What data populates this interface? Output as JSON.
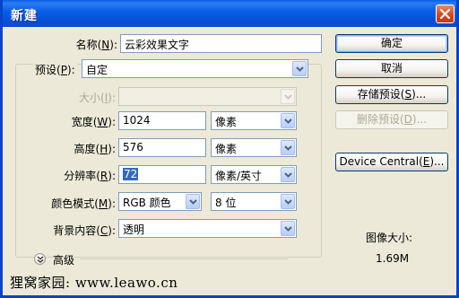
{
  "window": {
    "title": "新建",
    "close_icon": "close-icon"
  },
  "form": {
    "name": {
      "label": "名称(",
      "mnemonic": "N",
      "label_end": "):",
      "value": "云彩效果文字"
    },
    "preset": {
      "label": "预设(",
      "mnemonic": "P",
      "label_end": "):",
      "value": "自定"
    },
    "size": {
      "label": "大小(",
      "mnemonic": "I",
      "label_end": "):",
      "value": ""
    },
    "width": {
      "label": "宽度(",
      "mnemonic": "W",
      "label_end": "):",
      "value": "1024",
      "unit": "像素"
    },
    "height": {
      "label": "高度(",
      "mnemonic": "H",
      "label_end": "):",
      "value": "576",
      "unit": "像素"
    },
    "resolution": {
      "label": "分辨率(",
      "mnemonic": "R",
      "label_end": "):",
      "value": "72",
      "unit": "像素/英寸"
    },
    "color_mode": {
      "label": "颜色模式(",
      "mnemonic": "M",
      "label_end": "):",
      "value": "RGB 颜色",
      "bits": "8 位"
    },
    "background": {
      "label": "背景内容(",
      "mnemonic": "C",
      "label_end": "):",
      "value": "透明"
    },
    "advanced": {
      "label": "高级"
    }
  },
  "buttons": {
    "ok": "确定",
    "cancel": "取消",
    "save_preset": {
      "label": "存储预设(",
      "mnemonic": "S",
      "label_end": ")..."
    },
    "delete_preset": {
      "label": "删除预设(",
      "mnemonic": "D",
      "label_end": ")..."
    },
    "device_central": {
      "label": "Device Central(",
      "mnemonic": "E",
      "label_end": ")..."
    }
  },
  "image_size": {
    "label": "图像大小:",
    "value": "1.69M"
  },
  "watermark": "狸窝家园: www.leawo.cn",
  "colors": {
    "titlebar": "#0b5fe8",
    "dialog_bg": "#ece9d8",
    "selection": "#316ac5"
  }
}
